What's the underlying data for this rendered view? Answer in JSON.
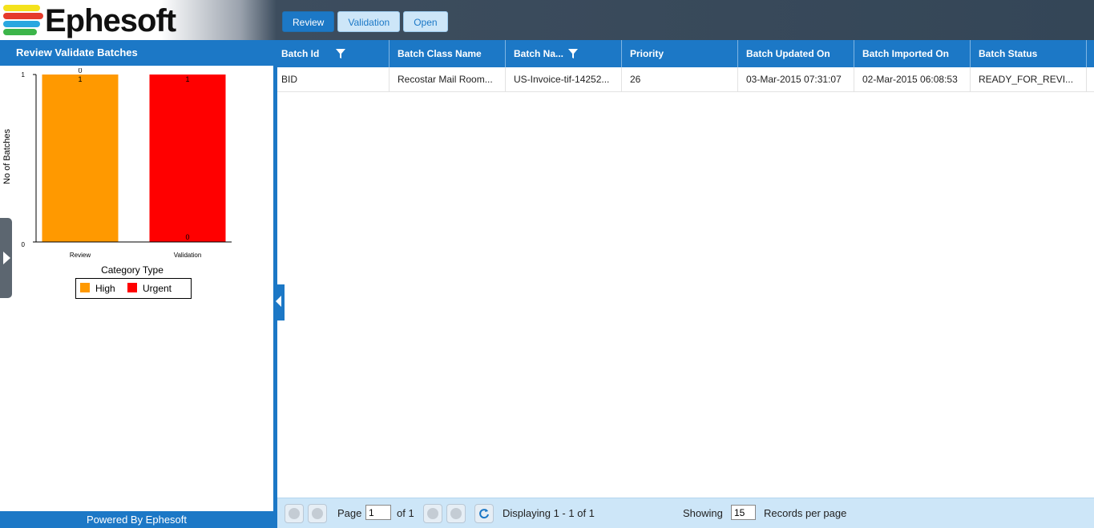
{
  "app": {
    "logo_text": "Ephesoft"
  },
  "nav": {
    "tabs": [
      "Review",
      "Validation",
      "Open"
    ],
    "active": "Review"
  },
  "left_panel": {
    "title": "Review Validate Batches",
    "footer": "Powered By Ephesoft"
  },
  "chart_data": {
    "type": "bar",
    "categories": [
      "Review",
      "Validation"
    ],
    "series": [
      {
        "name": "High",
        "color": "#ff9900",
        "values": [
          1,
          0
        ]
      },
      {
        "name": "Urgent",
        "color": "#ff0000",
        "values": [
          0,
          1
        ]
      }
    ],
    "stacked": true,
    "xlabel": "Category Type",
    "ylabel": "No of Batches",
    "ylim": [
      0,
      1
    ],
    "y_ticks": [
      "0",
      "1"
    ],
    "data_labels": [
      {
        "category": "Review",
        "top": "0",
        "inner": "1"
      },
      {
        "category": "Validation",
        "top": "",
        "inner": "1",
        "bottom": "0"
      }
    ],
    "legend": "bottom",
    "grid": false
  },
  "grid": {
    "columns": [
      "Batch Id",
      "Batch Class Name",
      "Batch Na...",
      "Priority",
      "Batch Updated On",
      "Batch Imported On",
      "Batch Status"
    ],
    "filter_columns": [
      "Batch Id",
      "Batch Na..."
    ],
    "rows": [
      [
        "BID",
        "Recostar Mail Room...",
        "US-Invoice-tif-14252...",
        "26",
        "03-Mar-2015 07:31:07",
        "02-Mar-2015 06:08:53",
        "READY_FOR_REVI..."
      ]
    ]
  },
  "pager": {
    "page_label": "Page",
    "page_value": "1",
    "of_label": "of 1",
    "displaying": "Displaying 1 - 1 of 1",
    "showing_label": "Showing",
    "records_value": "15",
    "records_label": "Records per page"
  },
  "colors": {
    "accent": "#1c78c6",
    "header_bg": "#344657",
    "pager_bg": "#cde6f8"
  }
}
